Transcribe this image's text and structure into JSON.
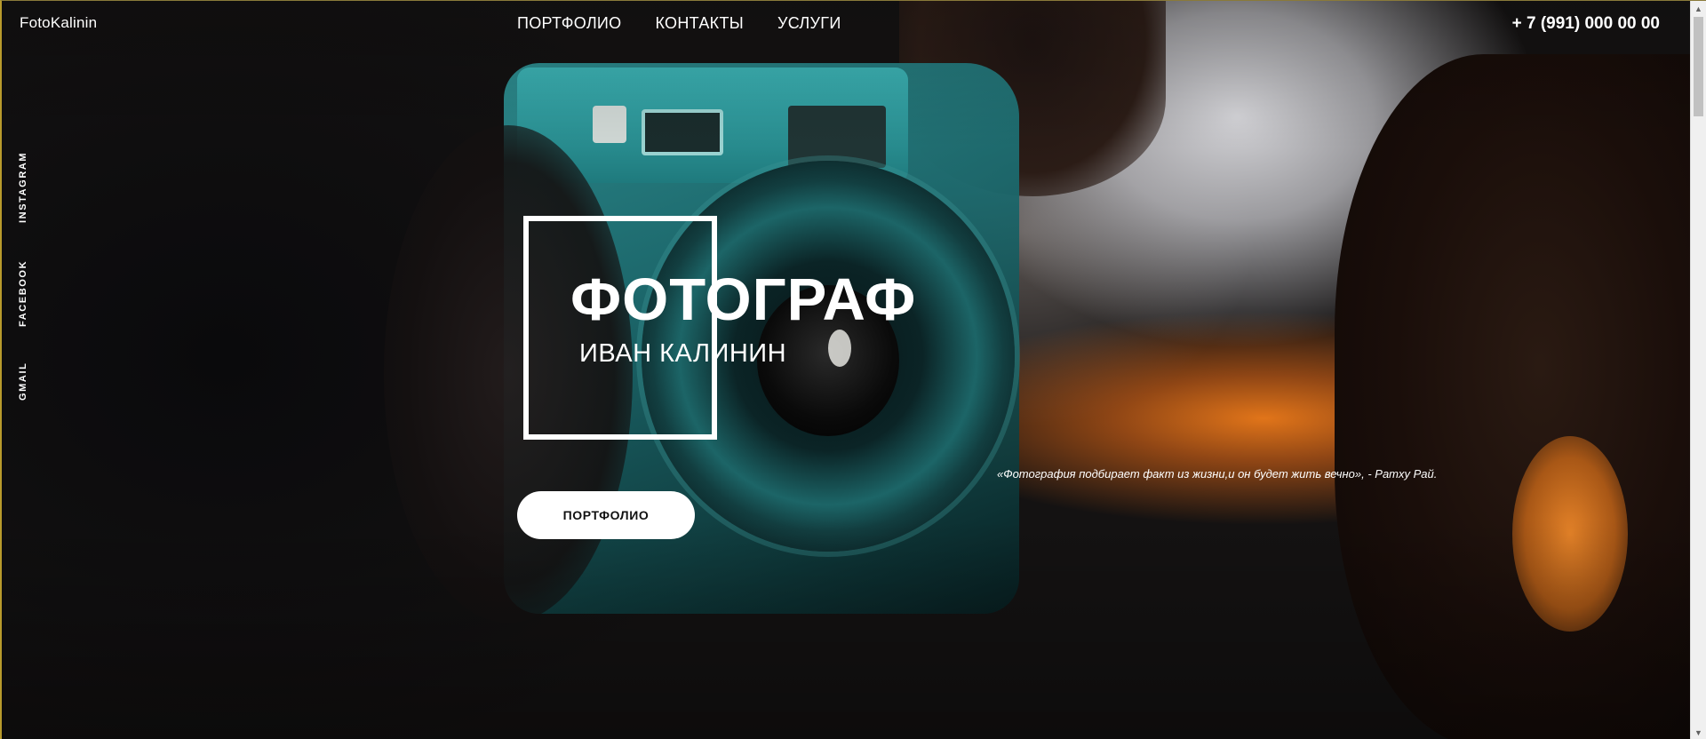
{
  "header": {
    "logo": "FotoKalinin",
    "nav": [
      {
        "label": "ПОРТФОЛИО"
      },
      {
        "label": "КОНТАКТЫ"
      },
      {
        "label": "УСЛУГИ"
      }
    ],
    "phone": "+ 7 (991) 000 00 00"
  },
  "social": {
    "instagram": "INSTAGRAM",
    "facebook": "FACEBOOK",
    "gmail": "GMAIL"
  },
  "hero": {
    "title": "ФОТОГРАФ",
    "subtitle": "ИВАН КАЛИНИН",
    "cta_label": "ПОРТФОЛИО",
    "quote": "«Фотография подбирает факт из жизни,и он будет жить вечно», - Ратху Рай."
  },
  "icons": {
    "scroll_up": "scroll-up-arrow-icon",
    "scroll_down": "scroll-down-arrow-icon"
  }
}
